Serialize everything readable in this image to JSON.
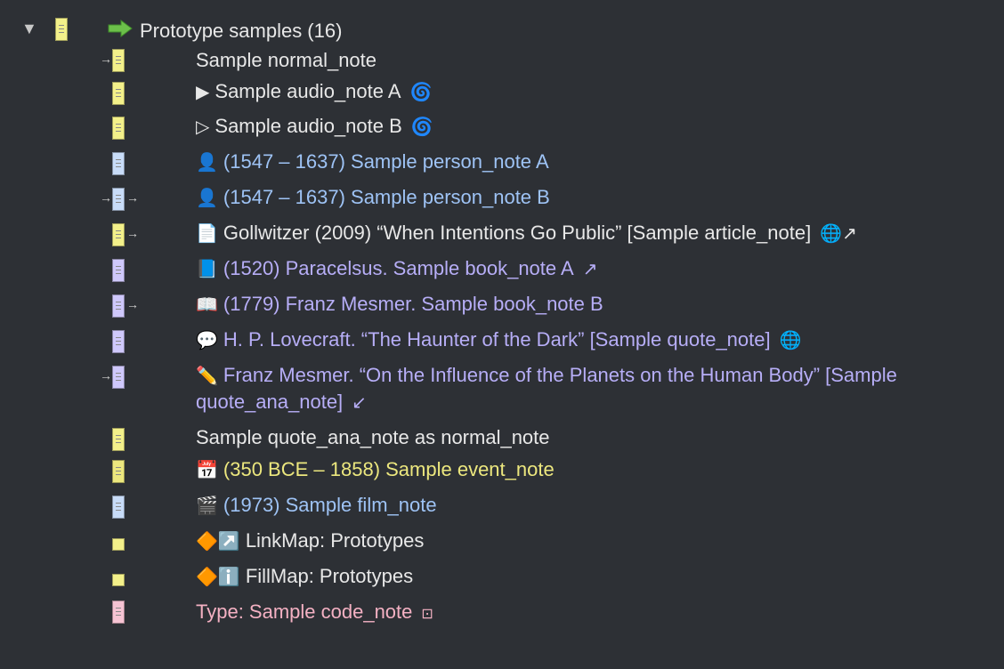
{
  "tree": {
    "root": {
      "title": "Prototype samples (16)",
      "disclosure": "▼",
      "arrow_icon": "green-right-arrow-icon"
    },
    "items": [
      {
        "label": "Sample normal_note",
        "glyph": "",
        "badge": ""
      },
      {
        "label": "Sample audio_note A",
        "glyph": "▶",
        "badge": "🌀"
      },
      {
        "label": "Sample audio_note B",
        "glyph": "▷",
        "badge": "🌀"
      },
      {
        "label": "(1547 – 1637) Sample person_note A",
        "glyph": "👤",
        "badge": ""
      },
      {
        "label": "(1547 – 1637) Sample person_note B",
        "glyph": "👤",
        "badge": ""
      },
      {
        "label": "Gollwitzer (2009) “When Intentions Go Public” [Sample article_note]",
        "glyph": "📄",
        "badge": "🌐↗"
      },
      {
        "label": "(1520) Paracelsus. Sample book_note A",
        "glyph": "📘",
        "badge": "↗"
      },
      {
        "label": "(1779) Franz Mesmer. Sample book_note B",
        "glyph": "📖",
        "badge": ""
      },
      {
        "label": "H. P. Lovecraft. “The Haunter of the Dark” [Sample quote_note]",
        "glyph": "💬",
        "badge": "🌐"
      },
      {
        "label": "Franz Mesmer. “On the Influence of the Planets on the Human Body” [Sample",
        "label2": "quote_ana_note]",
        "glyph": "✏️",
        "badge": "↙"
      },
      {
        "label": "Sample quote_ana_note as normal_note",
        "glyph": "",
        "badge": ""
      },
      {
        "label": "(350 BCE – 1858) Sample event_note",
        "glyph": "📅",
        "badge": ""
      },
      {
        "label": "(1973) Sample film_note",
        "glyph": "🎬",
        "badge": ""
      },
      {
        "label": "LinkMap: Prototypes",
        "glyph": "🔶↗️",
        "badge": ""
      },
      {
        "label": "FillMap: Prototypes",
        "glyph": "🔶ℹ️",
        "badge": ""
      },
      {
        "label": "Type: Sample code_note",
        "glyph": "",
        "badge": "⊡"
      }
    ]
  },
  "colors": {
    "background": "#2d3035",
    "note_yellow": "#f3f08a",
    "note_blue": "#c8dcf8",
    "note_purple": "#cfc8fb",
    "note_pink": "#f6c3d3",
    "text_white": "#e8e8e8",
    "text_blue": "#9ec3f5",
    "text_purple": "#b7aef7",
    "text_yellow": "#ece77e",
    "text_pink": "#f4b1c3"
  }
}
